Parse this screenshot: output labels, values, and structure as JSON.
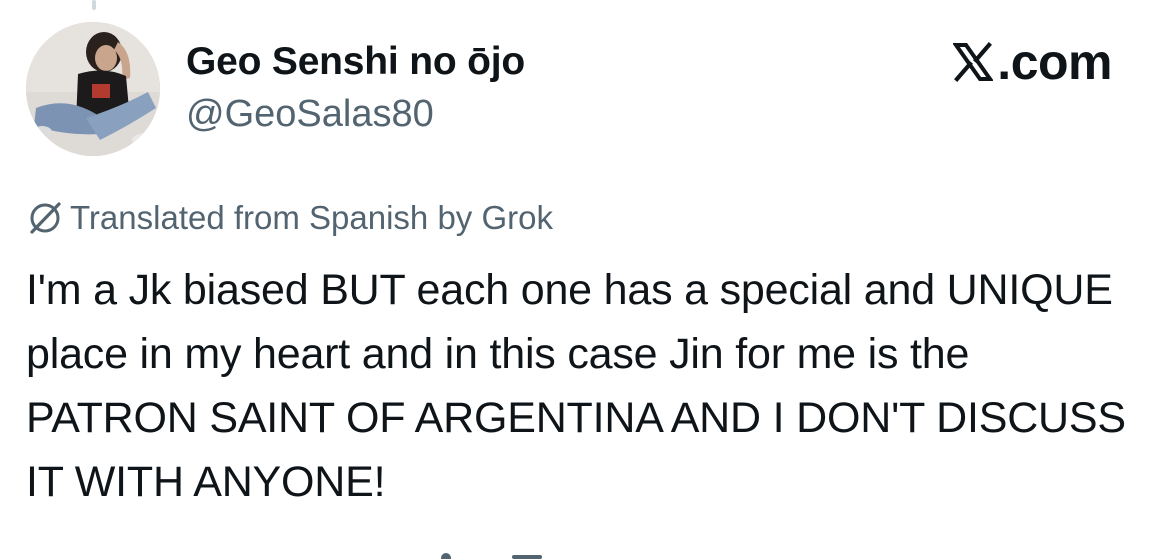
{
  "user": {
    "display_name": "Geo Senshi no ōjo",
    "handle": "@GeoSalas80",
    "avatar_icon": "profile-photo"
  },
  "brand": {
    "label": ".com",
    "logo_icon": "x-logo-icon"
  },
  "translation": {
    "label": "Translated from Spanish by Grok",
    "icon": "grok-icon"
  },
  "tweet": {
    "text": "I'm a Jk biased BUT each one has a special and UNIQUE place in my heart and in this case Jin for me is the PATRON SAINT OF ARGENTINA AND I DON'T DISCUSS IT WITH ANYONE!"
  },
  "colors": {
    "text_primary": "#0f1419",
    "text_secondary": "#536471",
    "background": "#ffffff"
  }
}
